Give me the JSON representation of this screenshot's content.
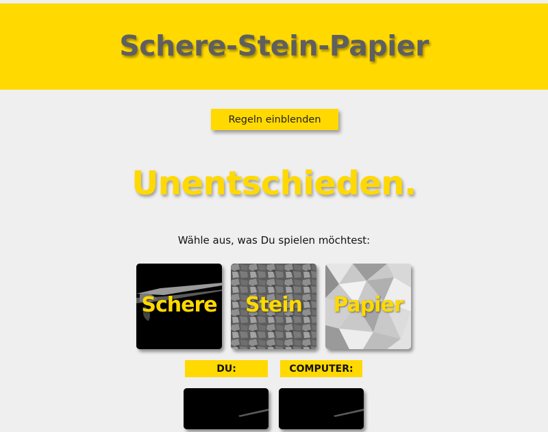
{
  "header": {
    "title": "Schere-Stein-Papier"
  },
  "rules_button": {
    "label": "Regeln einblenden"
  },
  "result": {
    "text": "Unentschieden."
  },
  "prompt": {
    "text": "Wähle aus, was Du spielen möchtest:"
  },
  "choices": [
    {
      "label": "Schere",
      "image": "scissors"
    },
    {
      "label": "Stein",
      "image": "gravel"
    },
    {
      "label": "Papier",
      "image": "crumpled-paper"
    }
  ],
  "scoreboard": {
    "player_label": "DU:",
    "computer_label": "COMPUTER:",
    "player_pick": "scissors",
    "computer_pick": "scissors"
  },
  "colors": {
    "accent": "#ffd900",
    "background": "#efeff0",
    "title": "#5f5f5f"
  }
}
